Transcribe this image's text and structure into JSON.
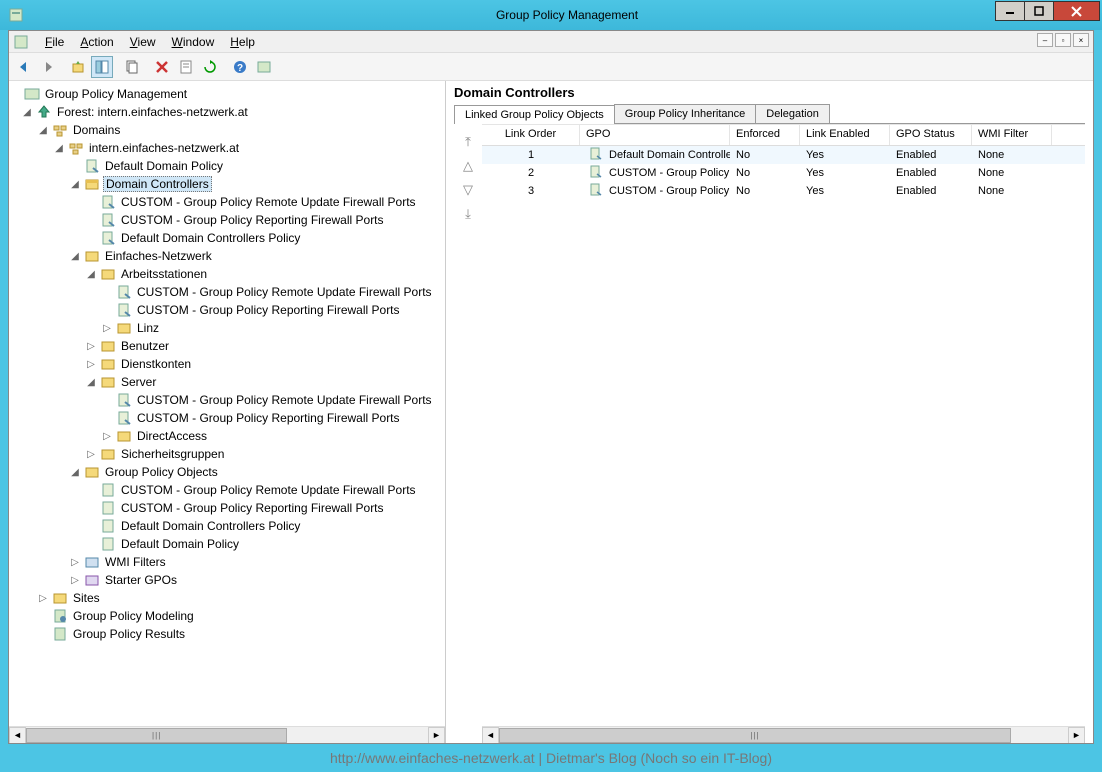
{
  "window": {
    "title": "Group Policy Management"
  },
  "menu": {
    "file": "File",
    "action": "Action",
    "view": "View",
    "window": "Window",
    "help": "Help"
  },
  "tree": {
    "root": "Group Policy Management",
    "forest": "Forest: intern.einfaches-netzwerk.at",
    "domains": "Domains",
    "domain1": "intern.einfaches-netzwerk.at",
    "ddp": "Default Domain Policy",
    "dc": "Domain Controllers",
    "dc_c1": "CUSTOM - Group Policy Remote Update Firewall Ports",
    "dc_c2": "CUSTOM - Group Policy Reporting Firewall Ports",
    "dc_c3": "Default Domain Controllers Policy",
    "en": "Einfaches-Netzwerk",
    "arb": "Arbeitsstationen",
    "arb_c1": "CUSTOM - Group Policy Remote Update Firewall Ports",
    "arb_c2": "CUSTOM - Group Policy Reporting Firewall Ports",
    "linz": "Linz",
    "ben": "Benutzer",
    "dien": "Dienstkonten",
    "serv": "Server",
    "serv_c1": "CUSTOM - Group Policy Remote Update Firewall Ports",
    "serv_c2": "CUSTOM - Group Policy Reporting Firewall Ports",
    "da": "DirectAccess",
    "sich": "Sicherheitsgruppen",
    "gpo": "Group Policy Objects",
    "gpo_c1": "CUSTOM - Group Policy Remote Update Firewall Ports",
    "gpo_c2": "CUSTOM - Group Policy Reporting Firewall Ports",
    "gpo_c3": "Default Domain Controllers Policy",
    "gpo_c4": "Default Domain Policy",
    "wmi": "WMI Filters",
    "starter": "Starter GPOs",
    "sites": "Sites",
    "gpm": "Group Policy Modeling",
    "gpr": "Group Policy Results"
  },
  "detail": {
    "title": "Domain Controllers",
    "tabs": {
      "linked": "Linked Group Policy Objects",
      "inherit": "Group Policy Inheritance",
      "deleg": "Delegation"
    },
    "columns": {
      "order": "Link Order",
      "gpo": "GPO",
      "enf": "Enforced",
      "link": "Link Enabled",
      "stat": "GPO Status",
      "wmi": "WMI Filter"
    },
    "rows": [
      {
        "order": "1",
        "gpo": "Default Domain Controlle...",
        "enf": "No",
        "link": "Yes",
        "stat": "Enabled",
        "wmi": "None"
      },
      {
        "order": "2",
        "gpo": "CUSTOM - Group Policy ...",
        "enf": "No",
        "link": "Yes",
        "stat": "Enabled",
        "wmi": "None"
      },
      {
        "order": "3",
        "gpo": "CUSTOM - Group Policy ...",
        "enf": "No",
        "link": "Yes",
        "stat": "Enabled",
        "wmi": "None"
      }
    ]
  },
  "footer": "http://www.einfaches-netzwerk.at | Dietmar's Blog (Noch so ein IT-Blog)"
}
